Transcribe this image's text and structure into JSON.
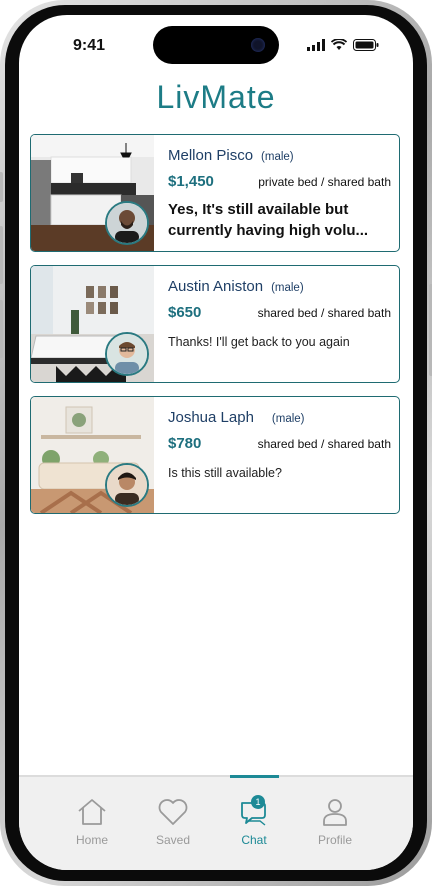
{
  "status_bar": {
    "time": "9:41"
  },
  "app": {
    "logo": "LivMate"
  },
  "listings": [
    {
      "name": "Mellon Pisco",
      "gender": "(male)",
      "price": "$1,450",
      "beds": "private bed / shared bath",
      "message": "Yes, It's still available but currently having high volu..."
    },
    {
      "name": "Austin Aniston",
      "gender": "(male)",
      "price": "$650",
      "beds": "shared bed / shared bath",
      "message": "Thanks! I'll get back to you again"
    },
    {
      "name": "Joshua Laph",
      "gender": "(male)",
      "price": "$780",
      "beds": "shared bed / shared bath",
      "message": "Is this still available?"
    }
  ],
  "tabbar": {
    "tabs": [
      {
        "label": "Home",
        "icon": "home-icon"
      },
      {
        "label": "Saved",
        "icon": "heart-icon"
      },
      {
        "label": "Chat",
        "icon": "chat-icon",
        "active": true,
        "badge": "1"
      },
      {
        "label": "Profile",
        "icon": "person-icon"
      }
    ]
  },
  "colors": {
    "accent": "#1d8a96",
    "card_border": "#1f6b72",
    "name": "#1f3f66"
  }
}
